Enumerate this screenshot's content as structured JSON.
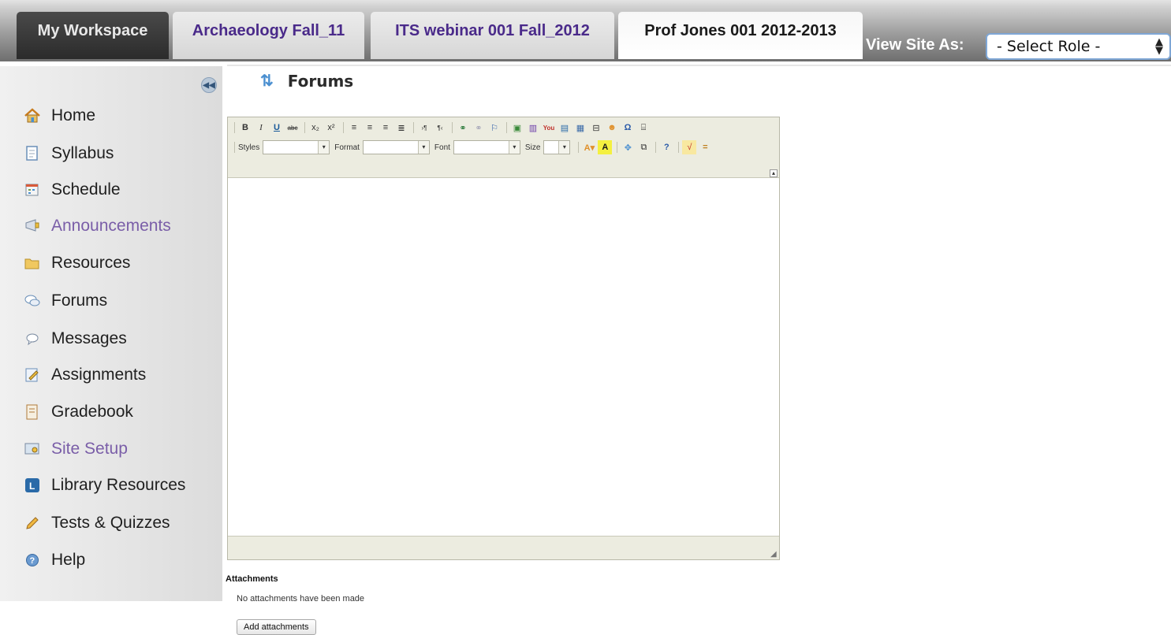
{
  "tabs": [
    {
      "label": "My Workspace"
    },
    {
      "label": "Archaeology Fall_11"
    },
    {
      "label": "ITS webinar 001 Fall_2012"
    },
    {
      "label": "Prof Jones 001 2012-2013"
    }
  ],
  "view_as": {
    "label": "View Site As:",
    "selected": "- Select Role -"
  },
  "sidebar": {
    "collapse_icon": "collapse-left-icon",
    "items": [
      {
        "label": "Home",
        "icon": "home-icon"
      },
      {
        "label": "Syllabus",
        "icon": "syllabus-icon"
      },
      {
        "label": "Schedule",
        "icon": "calendar-icon"
      },
      {
        "label": "Announcements",
        "icon": "announcements-icon"
      },
      {
        "label": "Resources",
        "icon": "folder-icon"
      },
      {
        "label": "Forums",
        "icon": "forums-icon"
      },
      {
        "label": "Messages",
        "icon": "messages-icon"
      },
      {
        "label": "Assignments",
        "icon": "assignments-icon"
      },
      {
        "label": "Gradebook",
        "icon": "gradebook-icon"
      },
      {
        "label": "Site Setup",
        "icon": "site-setup-icon"
      },
      {
        "label": "Library Resources",
        "icon": "library-icon"
      },
      {
        "label": "Tests & Quizzes",
        "icon": "pencil-icon"
      },
      {
        "label": "Help",
        "icon": "help-icon"
      }
    ]
  },
  "page": {
    "title": "Forums",
    "refresh_icon": "refresh-icon"
  },
  "editor": {
    "toolbar": {
      "styles_label": "Styles",
      "format_label": "Format",
      "font_label": "Font",
      "size_label": "Size"
    }
  },
  "attachments": {
    "title": "Attachments",
    "empty_text": "No attachments have been made",
    "add_button": "Add attachments"
  },
  "colors": {
    "site_tab_text": "#4a2a8a",
    "muted_nav": "#7a5ea8",
    "accent": "#7fa7d6"
  }
}
